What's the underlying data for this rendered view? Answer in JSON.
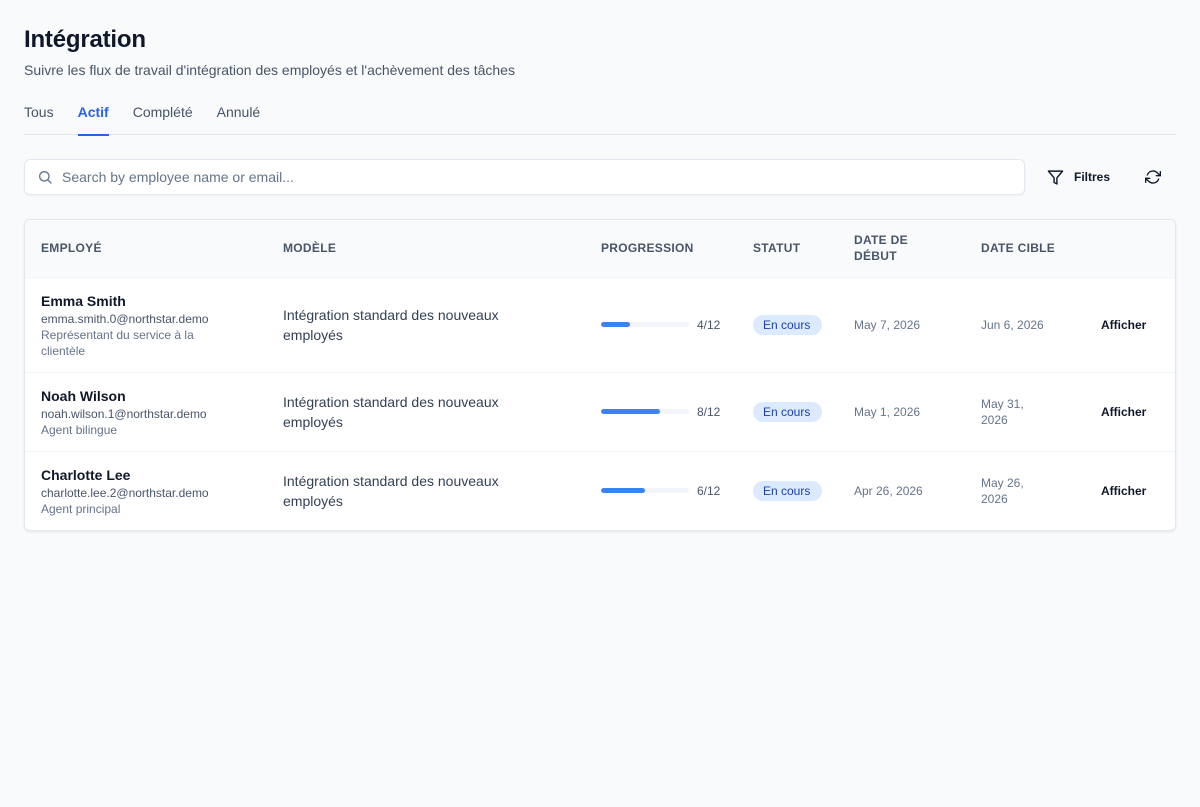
{
  "header": {
    "title": "Intégration",
    "subtitle": "Suivre les flux de travail d'intégration des employés et l'achèvement des tâches"
  },
  "tabs": [
    {
      "label": "Tous",
      "active": false
    },
    {
      "label": "Actif",
      "active": true
    },
    {
      "label": "Complété",
      "active": false
    },
    {
      "label": "Annulé",
      "active": false
    }
  ],
  "toolbar": {
    "search_placeholder": "Search by employee name or email...",
    "search_value": "",
    "filters_label": "Filtres"
  },
  "table": {
    "columns": [
      "Employé",
      "Modèle",
      "Progression",
      "Statut",
      "Date de début",
      "Date cible",
      ""
    ],
    "rows": [
      {
        "name": "Emma Smith",
        "email": "emma.smith.0@northstar.demo",
        "role": "Représentant du service à la clientèle",
        "template": "Intégration standard des nouveaux employés",
        "progress_done": 4,
        "progress_total": 12,
        "progress_label": "4/12",
        "status": "En cours",
        "start_date": "May 7, 2026",
        "target_date": "Jun 6, 2026",
        "action": "Afficher"
      },
      {
        "name": "Noah Wilson",
        "email": "noah.wilson.1@northstar.demo",
        "role": "Agent bilingue",
        "template": "Intégration standard des nouveaux employés",
        "progress_done": 8,
        "progress_total": 12,
        "progress_label": "8/12",
        "status": "En cours",
        "start_date": "May 1, 2026",
        "target_date": "May 31, 2026",
        "action": "Afficher"
      },
      {
        "name": "Charlotte Lee",
        "email": "charlotte.lee.2@northstar.demo",
        "role": "Agent principal",
        "template": "Intégration standard des nouveaux employés",
        "progress_done": 6,
        "progress_total": 12,
        "progress_label": "6/12",
        "status": "En cours",
        "start_date": "Apr 26, 2026",
        "target_date": "May 26, 2026",
        "action": "Afficher"
      }
    ]
  },
  "colors": {
    "accent": "#2563eb",
    "progress": "#3b82f6",
    "badge_bg": "#dbeafe",
    "badge_text": "#1e40af"
  },
  "icons": {
    "search": "search-icon",
    "filter": "filter-icon",
    "refresh": "refresh-icon"
  }
}
